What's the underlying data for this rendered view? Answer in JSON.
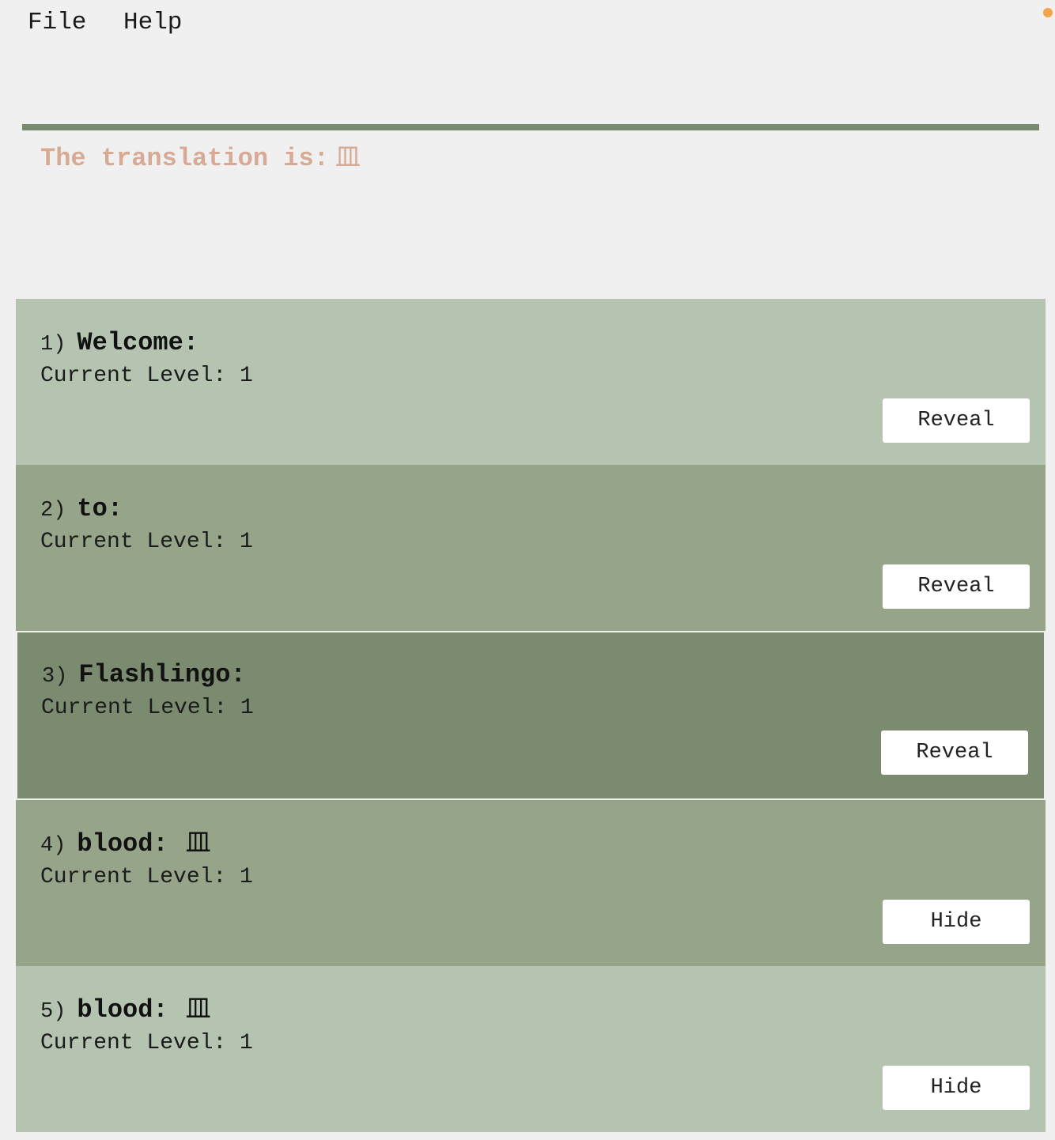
{
  "menu": {
    "file": "File",
    "help": "Help"
  },
  "status_dot_color": "#f2a54a",
  "translation": {
    "label": "The translation is:",
    "value": "皿"
  },
  "cards": [
    {
      "number": "1)",
      "word": "Welcome:",
      "translation": "",
      "level": "Current Level: 1",
      "button": "Reveal"
    },
    {
      "number": "2)",
      "word": "to:",
      "translation": "",
      "level": "Current Level: 1",
      "button": "Reveal"
    },
    {
      "number": "3)",
      "word": "Flashlingo:",
      "translation": "",
      "level": "Current Level: 1",
      "button": "Reveal"
    },
    {
      "number": "4)",
      "word": "blood:",
      "translation": "皿",
      "level": "Current Level: 1",
      "button": "Hide"
    },
    {
      "number": "5)",
      "word": "blood:",
      "translation": "皿",
      "level": "Current Level: 1",
      "button": "Hide"
    }
  ]
}
